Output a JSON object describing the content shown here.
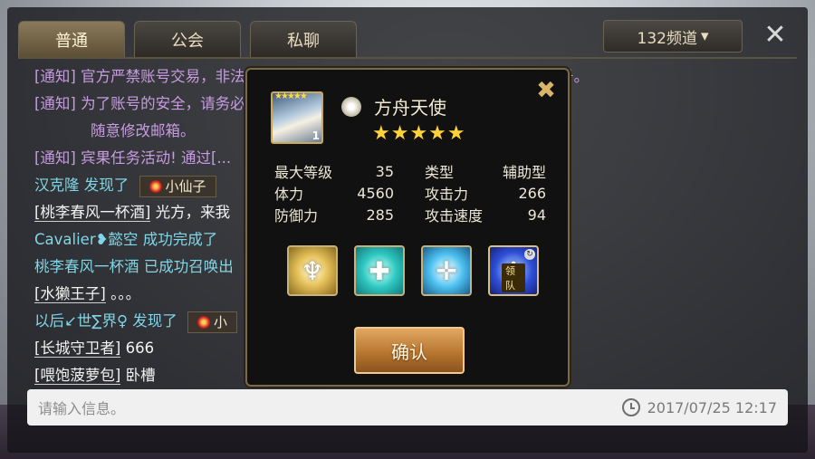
{
  "tabs": [
    {
      "label": "普通",
      "active": true
    },
    {
      "label": "公会",
      "active": false
    },
    {
      "label": "私聊",
      "active": false
    }
  ],
  "channel": {
    "label": "132频道",
    "arrow": "▾"
  },
  "close_glyph": "✕",
  "messages": {
    "m1": {
      "tag": "[通知]",
      "text": "官方严禁账号交易，非法渠道充值，作弊等行为，一经核实，立即永久封号。"
    },
    "m2": {
      "tag": "[通知]",
      "text": "为了账号的安全，请务必绑定手机和认证邮箱信息，防止账号被盗",
      "cont": "随意修改邮箱。"
    },
    "m3": {
      "tag": "[通知]",
      "text": "宾果任务活动! 通过[..."
    },
    "m4": {
      "name": "汉克隆",
      "verb": "发现了",
      "item": "小仙子"
    },
    "m5": {
      "player": "[桃李春风一杯酒]",
      "text": "光方，来我"
    },
    "m6": {
      "name": "Cavalier❥懿空",
      "verb": "成功完成了"
    },
    "m7": {
      "text": "桃李春风一杯酒 已成功召唤出"
    },
    "m8": {
      "player": "[水獭王子]",
      "text": "。。。"
    },
    "m9": {
      "name": "以后↙世∑界♀",
      "verb": "发现了",
      "item": "小"
    },
    "m10": {
      "player": "[长城守卫者]",
      "text": "666"
    },
    "m11": {
      "player": "[喂饱菠萝包]",
      "text": "卧槽"
    }
  },
  "input": {
    "placeholder": "请输入信息。",
    "timestamp": "2017/07/25  12:17"
  },
  "modal": {
    "close_glyph": "✖",
    "unit_name": "方舟天使",
    "stars": "★★★★★",
    "portrait_stars": "★★★★★",
    "portrait_level": "1",
    "stats": {
      "max_level_label": "最大等级",
      "max_level": "35",
      "type_label": "类型",
      "type": "辅助型",
      "hp_label": "体力",
      "hp": "4560",
      "atk_label": "攻击力",
      "atk": "266",
      "def_label": "防御力",
      "def": "285",
      "spd_label": "攻击速度",
      "spd": "94"
    },
    "skills": [
      {
        "icon": "wing-emblem-icon",
        "glyph": "♆"
      },
      {
        "icon": "heal-cross-icon",
        "glyph": "✚"
      },
      {
        "icon": "cross-arrows-icon",
        "glyph": "✛"
      },
      {
        "icon": "leader-skill-icon",
        "glyph": "♟",
        "badge": "领队"
      }
    ],
    "confirm_label": "确认"
  },
  "colors": {
    "notice": "#c79be0",
    "teal": "#7fd6e6",
    "gold_border": "#7a6a48",
    "confirm": "#c9853e"
  }
}
